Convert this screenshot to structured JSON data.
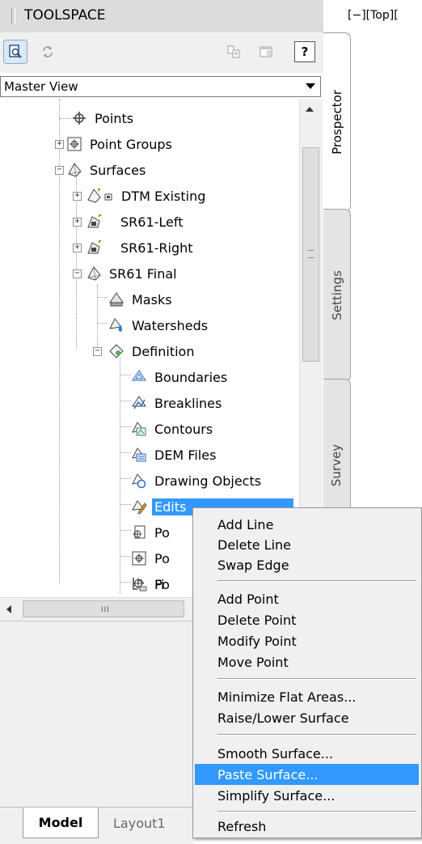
{
  "toolspace": {
    "title": "TOOLSPACE",
    "viewport_label": "[−][Top][",
    "toolbar": {
      "help_label": "?"
    },
    "view_selector": {
      "value": "Master View"
    },
    "tabs": [
      {
        "label": "Prospector",
        "active": true
      },
      {
        "label": "Settings",
        "active": false
      },
      {
        "label": "Survey",
        "active": false
      }
    ],
    "tree": [
      {
        "label": "Points",
        "icon": "points-icon"
      },
      {
        "label": "Point Groups",
        "icon": "point-groups-icon"
      },
      {
        "label": "Surfaces",
        "icon": "surfaces-icon"
      },
      {
        "label": "DTM Existing",
        "icon": "tin-surface-icon"
      },
      {
        "label": "SR61-Left",
        "icon": "grid-surface-icon"
      },
      {
        "label": "SR61-Right",
        "icon": "grid-surface-icon"
      },
      {
        "label": "SR61 Final",
        "icon": "tin-surface-icon"
      },
      {
        "label": "Masks",
        "icon": "masks-icon"
      },
      {
        "label": "Watersheds",
        "icon": "watersheds-icon"
      },
      {
        "label": "Definition",
        "icon": "definition-icon"
      },
      {
        "label": "Boundaries",
        "icon": "boundaries-icon"
      },
      {
        "label": "Breaklines",
        "icon": "breaklines-icon"
      },
      {
        "label": "Contours",
        "icon": "contours-icon"
      },
      {
        "label": "DEM Files",
        "icon": "dem-files-icon"
      },
      {
        "label": "Drawing Objects",
        "icon": "drawing-objects-icon"
      },
      {
        "label": "Edits",
        "icon": "edits-icon",
        "selected": true
      },
      {
        "label": "Po",
        "icon": "point-files-icon"
      },
      {
        "label": "Po",
        "icon": "point-groups-icon"
      },
      {
        "label": "Po",
        "icon": "point-survey-queries-icon"
      },
      {
        "label": "Fi",
        "icon": "figure-survey-queries-icon"
      }
    ],
    "hscroll_grip": "III"
  },
  "layout_tabs": {
    "model": "Model",
    "layout1": "Layout1"
  },
  "context_menu": {
    "items": [
      "Add Line",
      "Delete Line",
      "Swap Edge",
      "Add Point",
      "Delete Point",
      "Modify Point",
      "Move Point",
      "Minimize Flat Areas...",
      "Raise/Lower Surface",
      "Smooth Surface...",
      "Paste Surface...",
      "Simplify Surface...",
      "Refresh"
    ],
    "highlighted": "Paste Surface..."
  },
  "colors": {
    "selection": "#3399ff",
    "panel": "#f0f0f0",
    "titlebar": "#dcdcdc"
  }
}
